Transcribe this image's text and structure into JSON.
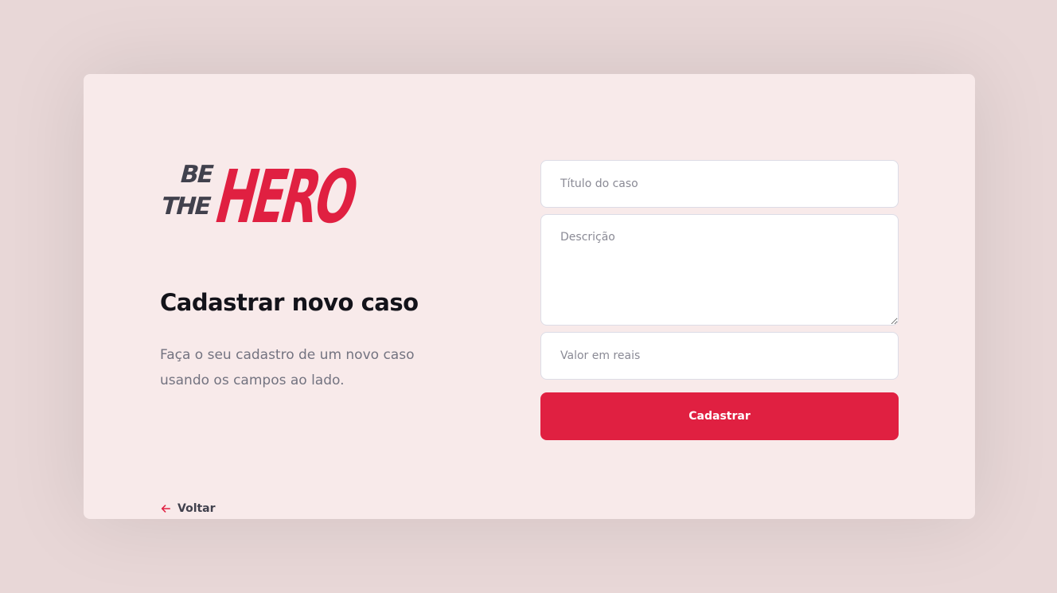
{
  "brand": {
    "logo_text_small_1": "BE",
    "logo_text_small_2": "THE",
    "logo_text_big": "HERO",
    "dark_color": "#41414d",
    "accent_color": "#e02041"
  },
  "left": {
    "title": "Cadastrar novo caso",
    "description": "Faça o seu cadastro de um novo caso usando os campos ao lado.",
    "back_label": "Voltar",
    "back_icon": "arrow-left-icon"
  },
  "form": {
    "title_placeholder": "Título do caso",
    "description_placeholder": "Descrição",
    "value_placeholder": "Valor em reais",
    "submit_label": "Cadastrar"
  }
}
